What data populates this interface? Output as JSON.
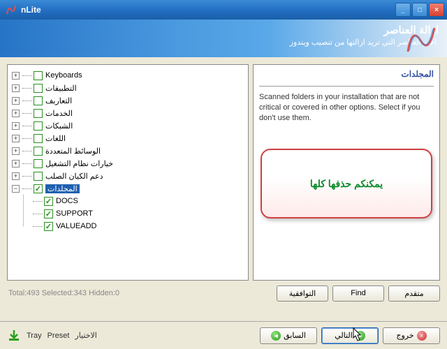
{
  "window": {
    "title": "nLite"
  },
  "header": {
    "title": "ازالة العناصر",
    "subtitle": ".اختر العناصر التي تريد ازالتها من تنصيب ويندوز"
  },
  "tree": {
    "items": [
      {
        "label": "Keyboards",
        "checked": false,
        "expander": "+"
      },
      {
        "label": "التطبيقات",
        "checked": false,
        "expander": "+"
      },
      {
        "label": "التعاريف",
        "checked": false,
        "expander": "+"
      },
      {
        "label": "الخدمات",
        "checked": false,
        "expander": "+"
      },
      {
        "label": "الشبكات",
        "checked": false,
        "expander": "+"
      },
      {
        "label": "اللغات",
        "checked": false,
        "expander": "+"
      },
      {
        "label": "الوسائط المتعددة",
        "checked": false,
        "expander": "+"
      },
      {
        "label": "خيارات نظام التشغيل",
        "checked": false,
        "expander": "+"
      },
      {
        "label": "دعم الكيان الصلب",
        "checked": false,
        "expander": "+"
      },
      {
        "label": "المجلدات",
        "checked": true,
        "expander": "−",
        "selected": true
      }
    ],
    "children": [
      {
        "label": "DOCS",
        "checked": true
      },
      {
        "label": "SUPPORT",
        "checked": true
      },
      {
        "label": "VALUEADD",
        "checked": true
      }
    ]
  },
  "right": {
    "title": "المجلدات",
    "desc": "Scanned folders in your installation that are not critical or covered in other options. Select if you don't use them."
  },
  "callout": {
    "text": "يمكنكم حذفها كلها"
  },
  "status": {
    "text": "Total:493 Selected:343 Hidden:0"
  },
  "buttons": {
    "compat": "التوافقية",
    "find": "Find",
    "advanced": "متقدم",
    "tray": "Tray",
    "preset": "Preset",
    "choice": "الاختيار",
    "back": "السابق",
    "next": "التالي",
    "exit": "خروج"
  }
}
